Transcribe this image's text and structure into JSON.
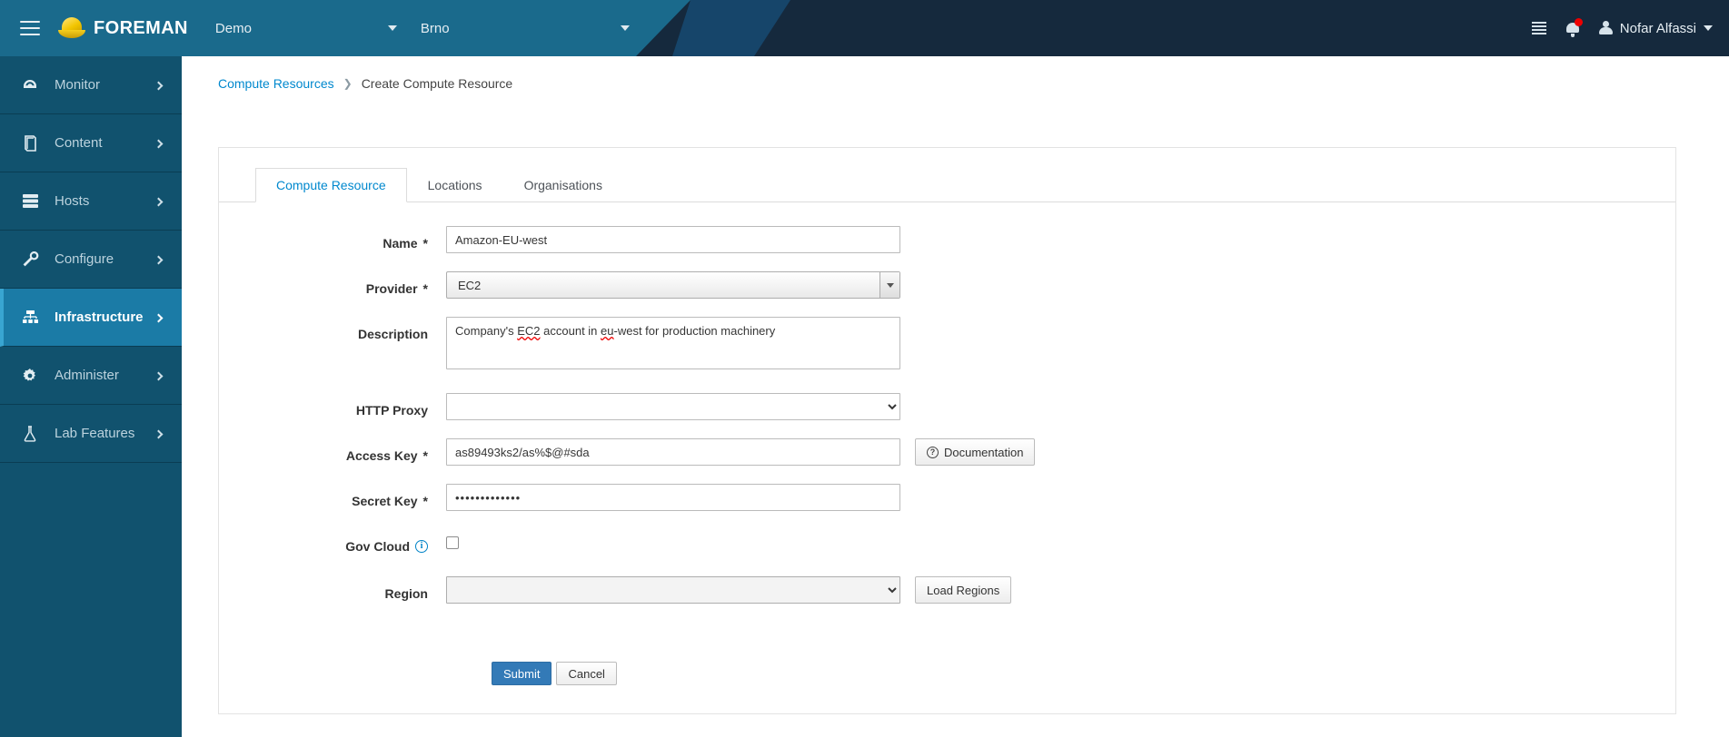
{
  "header": {
    "menu_icon": "hamburger-icon",
    "logo_icon": "hardhat-logo-icon",
    "brand": "FOREMAN",
    "org_selector": "Demo",
    "location_selector": "Brno",
    "list_icon": "list-icon",
    "notifications_icon": "bell-icon",
    "user_icon": "person-icon",
    "user_name": "Nofar Alfassi",
    "bg_left": "#1a6a8c",
    "bg_right": "#15293d"
  },
  "sidebar": {
    "items": [
      {
        "label": "Monitor",
        "icon": "dashboard-icon",
        "active": false
      },
      {
        "label": "Content",
        "icon": "book-icon",
        "active": false
      },
      {
        "label": "Hosts",
        "icon": "server-stack-icon",
        "active": false
      },
      {
        "label": "Configure",
        "icon": "wrench-icon",
        "active": false
      },
      {
        "label": "Infrastructure",
        "icon": "network-icon",
        "active": true
      },
      {
        "label": "Administer",
        "icon": "gear-icon",
        "active": false
      },
      {
        "label": "Lab Features",
        "icon": "flask-icon",
        "active": false
      }
    ],
    "active_color": "#1b7ba6",
    "bg_color": "#11526e"
  },
  "breadcrumb": {
    "parent": "Compute Resources",
    "separator": "❯",
    "current": "Create Compute Resource",
    "link_color": "#0088ce"
  },
  "tabs": [
    {
      "label": "Compute Resource",
      "active": true
    },
    {
      "label": "Locations",
      "active": false
    },
    {
      "label": "Organisations",
      "active": false
    }
  ],
  "form": {
    "name": {
      "label": "Name",
      "required": "*",
      "value": "Amazon-EU-west",
      "placeholder": ""
    },
    "provider": {
      "label": "Provider",
      "required": "*",
      "value": "EC2",
      "caret_icon": "caret-down-icon"
    },
    "description": {
      "label": "Description",
      "value": "Company's EC2 account in eu-west for production machinery",
      "spellcheck_words": [
        "EC2",
        "eu"
      ]
    },
    "http_proxy": {
      "label": "HTTP Proxy",
      "value": "",
      "placeholder": ""
    },
    "access_key": {
      "label": "Access Key",
      "required": "*",
      "value": "as89493ks2/as%$@#sda",
      "placeholder": "",
      "doc_button": {
        "label": "Documentation",
        "icon": "question-circle-icon"
      }
    },
    "secret_key": {
      "label": "Secret Key",
      "required": "*",
      "value": "•••••••••••••",
      "placeholder": ""
    },
    "gov_cloud": {
      "label": "Gov Cloud",
      "info_icon": "info-circle-icon",
      "checked": false
    },
    "region": {
      "label": "Region",
      "value": "",
      "load_button": "Load Regions"
    }
  },
  "actions": {
    "submit": "Submit",
    "cancel": "Cancel",
    "submit_color": "#337ab7"
  }
}
